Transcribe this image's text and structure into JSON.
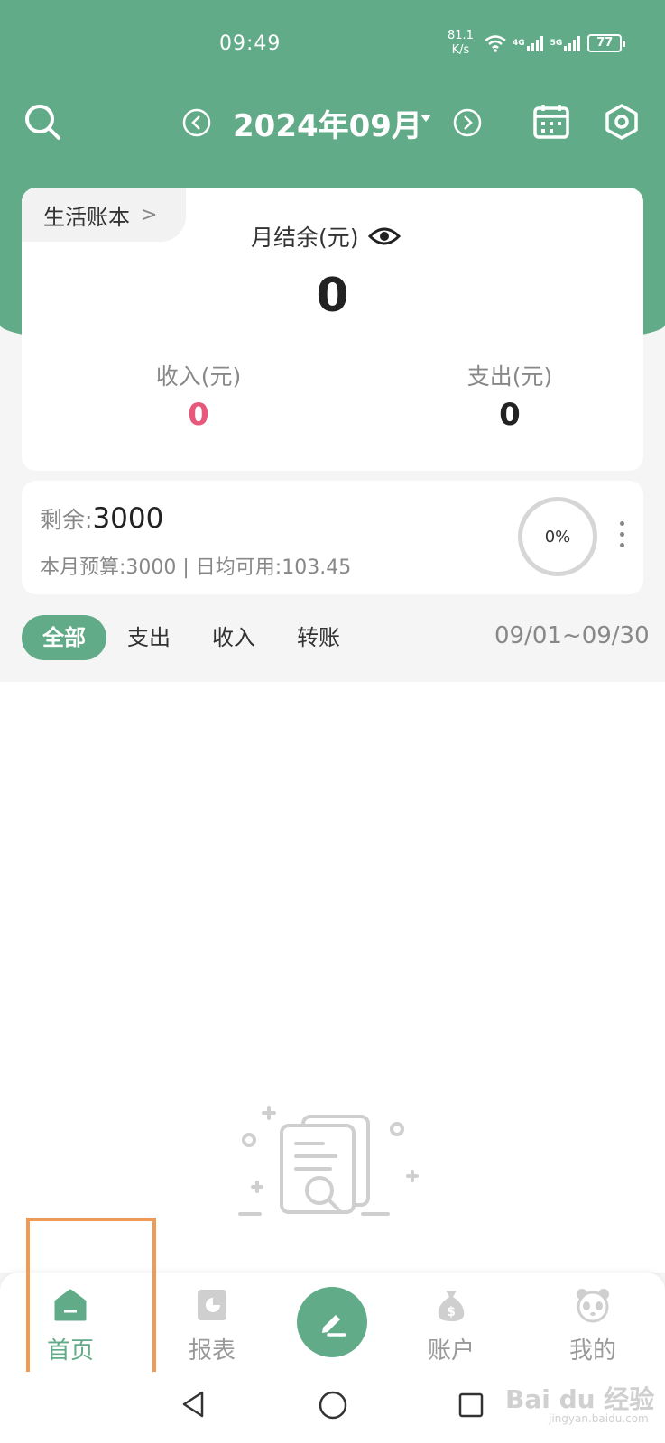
{
  "status_bar": {
    "time": "09:49",
    "speed_value": "81.1",
    "speed_unit": "K/s",
    "net_4g": "4G",
    "net_5g": "5G",
    "battery": "77"
  },
  "header": {
    "month": "2024年09月",
    "icons": [
      "search-icon",
      "prev-month-icon",
      "next-month-icon",
      "calendar-icon",
      "settings-icon"
    ]
  },
  "summary": {
    "book_name": "生活账本",
    "balance_label": "月结余(元)",
    "balance_value": "0",
    "income_label": "收入(元)",
    "income_value": "0",
    "expense_label": "支出(元)",
    "expense_value": "0"
  },
  "budget": {
    "remaining_label": "剩余:",
    "remaining_value": "3000",
    "detail": "本月预算:3000 | 日均可用:103.45",
    "percent": "0%"
  },
  "filters": {
    "tabs": [
      "全部",
      "支出",
      "收入",
      "转账"
    ],
    "active": "全部",
    "date_range": "09/01~09/30"
  },
  "bottom_nav": {
    "items": [
      {
        "label": "首页",
        "icon": "home-icon"
      },
      {
        "label": "报表",
        "icon": "report-icon"
      },
      {
        "label": "账户",
        "icon": "money-bag-icon"
      },
      {
        "label": "我的",
        "icon": "panda-icon"
      }
    ],
    "fab_icon": "edit-icon"
  },
  "watermark": {
    "text": "Bai du 经验",
    "sub": "jingyan.baidu.com"
  },
  "colors": {
    "brand_green": "#62ab88",
    "income_pink": "#e8587a",
    "highlight_orange": "#ef9b55"
  }
}
